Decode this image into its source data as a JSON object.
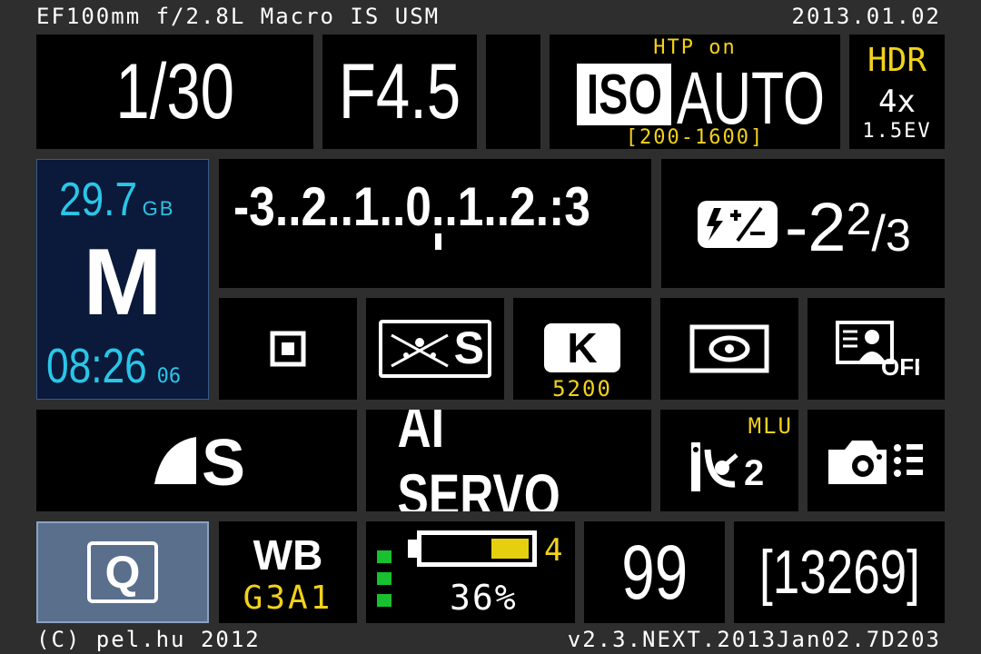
{
  "header": {
    "lens": "EF100mm f/2.8L Macro IS USM",
    "date": "2013.01.02"
  },
  "exposure": {
    "shutter": "1/30",
    "aperture": "F4.5"
  },
  "iso": {
    "htp": "HTP on",
    "label": "ISO",
    "value": "AUTO",
    "range": "[200-1600]"
  },
  "hdr": {
    "label": "HDR",
    "frames": "4x",
    "ev": "1.5EV"
  },
  "card": {
    "free": "29.7",
    "unit": "GB",
    "mode": "M",
    "time": "08:26",
    "seconds": "06"
  },
  "meter": {
    "scale": "-3..2..1..0..1..2.:3"
  },
  "flash_comp": {
    "value": "-2",
    "num": "2",
    "den": "3"
  },
  "drive_row": {
    "wb_kelvin": "5200",
    "k_label": "K",
    "picture_style": "S"
  },
  "row4": {
    "quality": "S",
    "af_mode": "AI SERVO",
    "mlu": "MLU",
    "drive_sub": "2"
  },
  "bottom": {
    "q_label": "Q",
    "wb_label": "WB",
    "wb_shift": "G3A1",
    "battery_pct": "36%",
    "battery_count": "4",
    "shots": "99",
    "remaining": "[13269]"
  },
  "battery": {
    "level": 0.36
  },
  "footer": {
    "copyright": "(C) pel.hu 2012",
    "version": "v2.3.NEXT.2013Jan02.7D203"
  },
  "colors": {
    "bg": "#2e2e2e",
    "yellow": "#f2d21a",
    "cyan": "#29c6e8",
    "mode_panel": "#0b1a3a",
    "q_button": "#5a6f8c"
  }
}
